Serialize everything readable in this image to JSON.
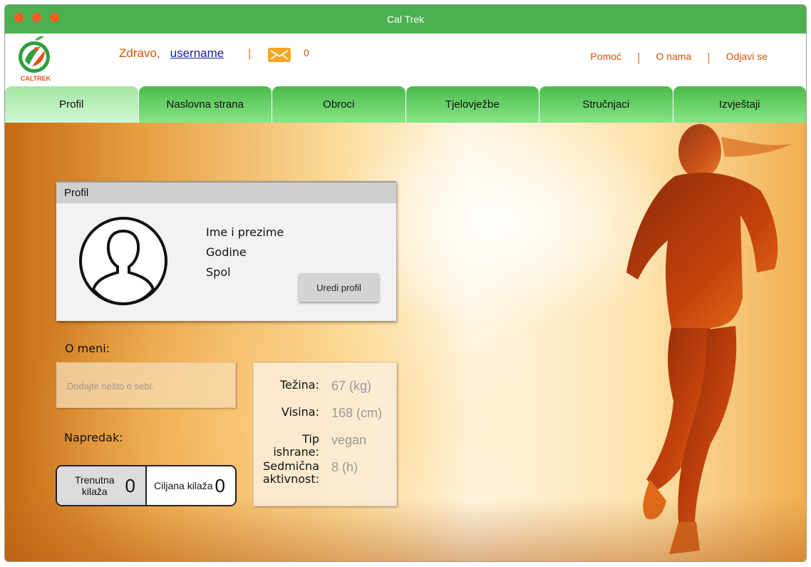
{
  "window": {
    "title": "Cal Trek"
  },
  "logo": {
    "text": "CALTREK"
  },
  "header": {
    "greeting": "Zdravo,",
    "username": "username",
    "separator": "|",
    "message_count": "0",
    "links": [
      "Pomoć",
      "O nama",
      "Odjavi se"
    ]
  },
  "tabs": [
    "Profil",
    "Naslovna strana",
    "Obroci",
    "Tjelovježbe",
    "Stručnjaci",
    "Izvještaji"
  ],
  "profile": {
    "panel_title": "Profil",
    "fields": [
      "Ime i prezime",
      "Godine",
      "Spol"
    ],
    "edit_button": "Uredi profil"
  },
  "about": {
    "label": "O meni:",
    "placeholder": "Dodajte nešto o sebi."
  },
  "progress": {
    "label": "Napredak:",
    "current_label": "Trenutna kilaža",
    "current_value": "0",
    "target_label": "Ciljana kilaža",
    "target_value": "0"
  },
  "stats": [
    {
      "key": "Težina:",
      "value": "67 (kg)"
    },
    {
      "key": "Visina:",
      "value": "168 (cm)"
    },
    {
      "key": "Tip ishrane:",
      "value": "vegan"
    },
    {
      "key": "Sedmična aktivnost:",
      "value": "8 (h)"
    }
  ],
  "colors": {
    "titlebar": "#4caf50",
    "accent": "#d35400",
    "tab": "#4cbb4c",
    "tab_active": "#c4f0c4"
  }
}
